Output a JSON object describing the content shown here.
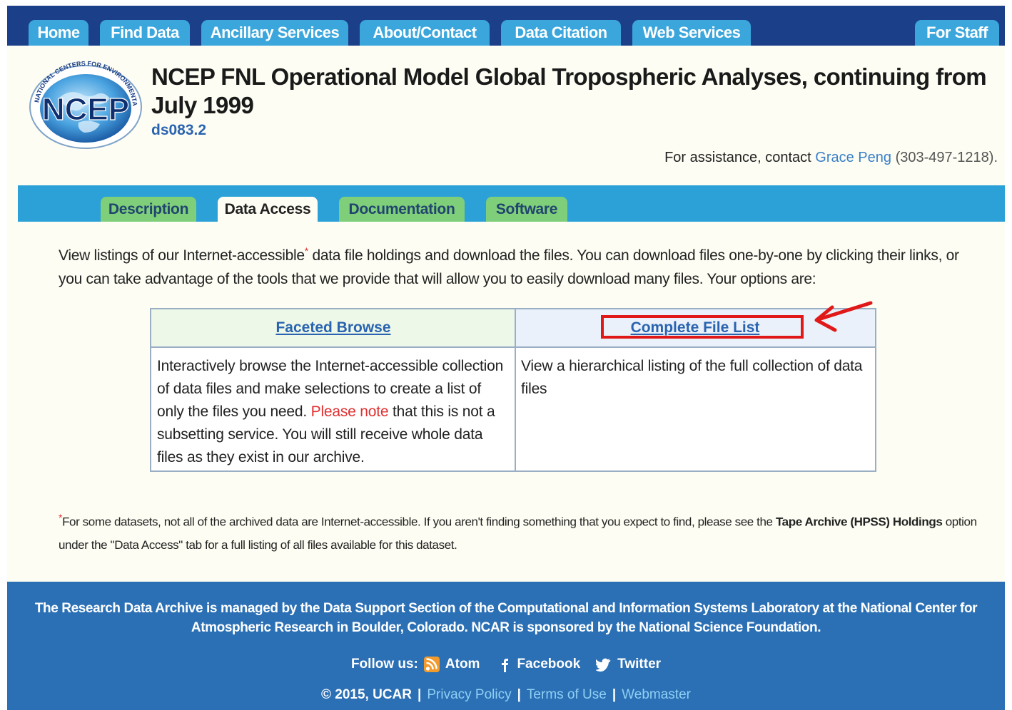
{
  "nav": {
    "home": "Home",
    "find_data": "Find Data",
    "ancillary": "Ancillary Services",
    "about": "About/Contact",
    "citation": "Data Citation",
    "web_services": "Web Services",
    "for_staff": "For Staff"
  },
  "logo": {
    "text": "NCEP",
    "ring_text": "NATIONAL CENTERS FOR ENVIRONMENTAL PREDICTION"
  },
  "header": {
    "title": "NCEP FNL Operational Model Global Tropospheric Analyses, continuing from July 1999",
    "dataset_id": "ds083.2",
    "assist_prefix": "For assistance, contact ",
    "assist_name": "Grace Peng",
    "assist_phone": " (303-497-1218)."
  },
  "tabs": {
    "description": "Description",
    "data_access": "Data Access",
    "documentation": "Documentation",
    "software": "Software"
  },
  "intro": {
    "part1": "View listings of our Internet-accessible",
    "mark": "*",
    "part2": " data file holdings and download the files. You can download files one-by-one by clicking their links, or you can take advantage of the tools that we provide that will allow you to easily download many files. Your options are:"
  },
  "options": {
    "faceted_title": "Faceted Browse",
    "faceted_desc1": "Interactively browse the Internet-accessible collection of data files and make selections to create a list of only the files you need. ",
    "faceted_note": "Please note",
    "faceted_desc2": " that this is not a subsetting service. You will still receive whole data files as they exist in our archive.",
    "complete_title": "Complete File List",
    "complete_desc": "View a hierarchical listing of the full collection of data files"
  },
  "footnote": {
    "mark": "*",
    "part1": "For some datasets, not all of the archived data are Internet-accessible. If you aren't finding something that you expect to find, please see the ",
    "bold": "Tape Archive (HPSS) Holdings",
    "part2": " option under the \"Data Access\" tab for a full listing of all files available for this dataset."
  },
  "footer": {
    "text": "The Research Data Archive is managed by the Data Support Section of the Computational and Information Systems Laboratory at the National Center for Atmospheric Research in Boulder, Colorado. NCAR is sponsored by the National Science Foundation.",
    "follow": "Follow us:",
    "atom": "Atom",
    "facebook": "Facebook",
    "twitter": "Twitter",
    "copyright": "© 2015, UCAR",
    "privacy": "Privacy Policy",
    "terms": "Terms of Use",
    "webmaster": "Webmaster",
    "separator": "|"
  },
  "colors": {
    "nav_bg": "#1b3f88",
    "nav_tab": "#3ba6dc",
    "tab_bar": "#2ba1d8",
    "tab_inactive": "#7ece7a",
    "footer_bg": "#2b70b5",
    "highlight": "#e01818"
  }
}
